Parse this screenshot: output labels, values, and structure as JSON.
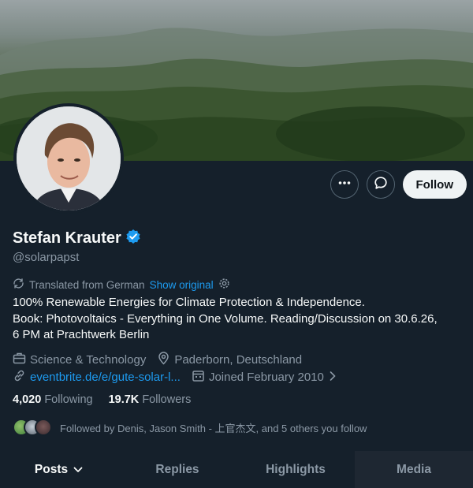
{
  "profile": {
    "display_name": "Stefan Krauter",
    "handle": "@solarpapst",
    "verified": true
  },
  "actions": {
    "more_icon": "more-icon",
    "message_icon": "message-icon",
    "follow_label": "Follow"
  },
  "translation": {
    "notice": "Translated from German",
    "show_original": "Show original"
  },
  "bio": {
    "line1": "100% Renewable Energies for Climate Protection & Independence.",
    "line2": "Book: Photovoltaics - Everything in One Volume. Reading/Discussion on 30.6.26,",
    "line3": "6 PM at Prachtwerk Berlin"
  },
  "meta": {
    "category": "Science & Technology",
    "location": "Paderborn, Deutschland",
    "link": "eventbrite.de/e/gute-solar-l...",
    "joined": "Joined February 2010"
  },
  "stats": {
    "following_count": "4,020",
    "following_label": "Following",
    "followers_count": "19.7K",
    "followers_label": "Followers"
  },
  "followed_by": "Followed by Denis, Jason Smith - 上官杰文, and 5 others you follow",
  "tabs": [
    {
      "label": "Posts"
    },
    {
      "label": "Replies"
    },
    {
      "label": "Highlights"
    },
    {
      "label": "Media"
    }
  ],
  "colors": {
    "background": "#15202b",
    "accent": "#1d9bf0",
    "secondary_text": "#8b98a5",
    "primary_text": "#f7f9f9"
  }
}
